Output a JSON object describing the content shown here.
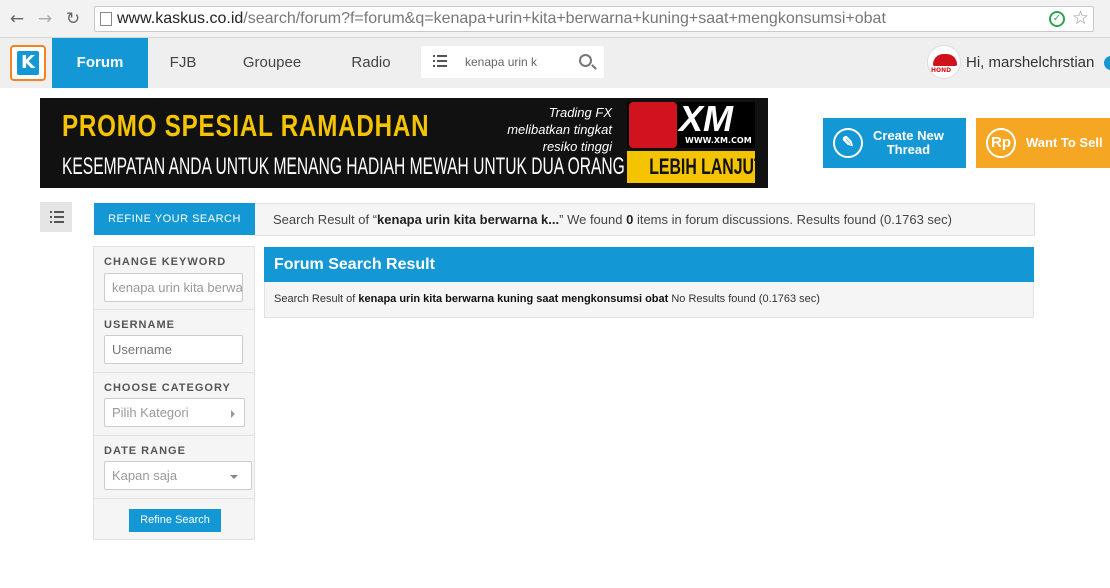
{
  "browser": {
    "back_icon": "←",
    "forward_icon": "→",
    "reload_icon": "↻",
    "url_domain": "www.kaskus.co.id",
    "url_path": "/search/forum?f=forum&q=kenapa+urin+kita+berwarna+kuning+saat+mengkonsumsi+obat",
    "secure_check": "✓",
    "bookmark_star": "☆"
  },
  "topnav": {
    "logo_letter": "K",
    "tabs": [
      {
        "label": "Forum",
        "active": true
      },
      {
        "label": "FJB",
        "active": false
      },
      {
        "label": "Groupee",
        "active": false
      },
      {
        "label": "Radio",
        "active": false
      }
    ],
    "search_value": "kenapa urin k",
    "greeting": "Hi, marshelchrstian",
    "avatar_text": "HOND"
  },
  "banner": {
    "headline": "PROMO SPESIAL RAMADHAN",
    "subline": "KESEMPATAN ANDA UNTUK MENANG HADIAH MEWAH UNTUK DUA ORANG",
    "risk_note": "Trading FX melibatkan tingkat resiko tinggi",
    "brand": "XM",
    "brand_url": "WWW.XM.COM",
    "cta": "LEBIH LANJUT"
  },
  "actions": {
    "create_label_1": "Create New",
    "create_label_2": "Thread",
    "create_icon": "✎",
    "sell_label": "Want To Sell",
    "sell_icon": "Rp"
  },
  "refine": {
    "tab_label": "REFINE YOUR SEARCH",
    "keyword_label": "CHANGE KEYWORD",
    "keyword_value": "kenapa urin kita berwarna kuning saat mengkonsumsi obat",
    "username_label": "USERNAME",
    "username_placeholder": "Username",
    "category_label": "CHOOSE CATEGORY",
    "category_value": "Pilih Kategori",
    "date_label": "DATE RANGE",
    "date_value": "Kapan saja",
    "button_label": "Refine Search"
  },
  "summary": {
    "prefix": "Search Result of “",
    "query_short": "kenapa urin kita berwarna k...",
    "mid": "” We found ",
    "count": "0",
    "suffix": " items in forum discussions. Results found (0.1763 sec)"
  },
  "result": {
    "title": "Forum Search Result",
    "prefix": "Search Result of ",
    "query": "kenapa urin kita berwarna kuning saat mengkonsumsi obat",
    "suffix": " No Results found (0.1763 sec)"
  },
  "colors": {
    "accent": "#1498d5",
    "orange": "#f5a623",
    "banner_yellow": "#f5c400"
  }
}
